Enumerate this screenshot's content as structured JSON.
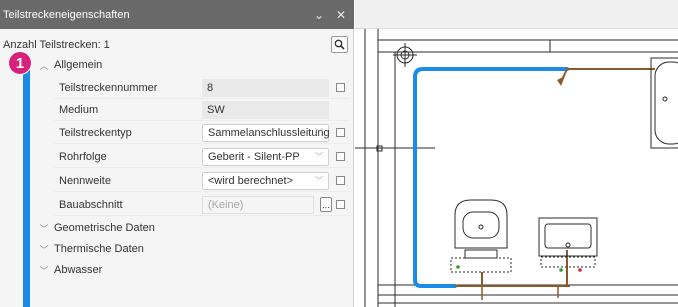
{
  "panel": {
    "title": "Teilstreckeneigenschaften",
    "title_buttons": {
      "pin": "⌄",
      "close": "✕"
    },
    "count_label": "Anzahl Teilstrecken: 1",
    "search_icon": "search-icon",
    "step_badge": "1",
    "sections": {
      "allgemein": "Allgemein",
      "geometrie": "Geometrische Daten",
      "thermisch": "Thermische Daten",
      "abwasser": "Abwasser"
    },
    "properties": [
      {
        "label": "Teilstreckennummer",
        "value": "8"
      },
      {
        "label": "Medium",
        "value": "SW"
      },
      {
        "label": "Teilstreckentyp",
        "value": "Sammelanschlussleitung"
      },
      {
        "label": "Rohrfolge",
        "value": "Geberit - Silent-PP"
      },
      {
        "label": "Nennweite",
        "value": "<wird berechnet>"
      },
      {
        "label": "Bauabschnitt",
        "value": "(Keine)",
        "button": "..."
      }
    ]
  },
  "colors": {
    "accent": "#1a8ce8",
    "badge": "#d8217d",
    "pipe_brown": "#8b5a2b",
    "titlebar": "#6a6a6a"
  }
}
